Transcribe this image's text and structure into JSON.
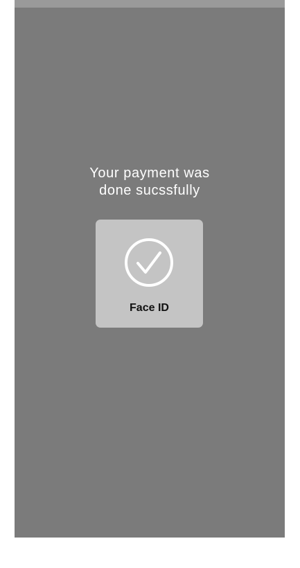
{
  "message": {
    "line1": "Your payment was",
    "line2": "done sucssfully"
  },
  "faceid": {
    "label": "Face ID",
    "icon": "checkmark-circle-icon"
  },
  "colors": {
    "overlay": "#7b7b7b",
    "status_bar": "#9a9a9a",
    "card": "#c4c4c4",
    "text_light": "#ffffff",
    "text_dark": "#111111"
  }
}
